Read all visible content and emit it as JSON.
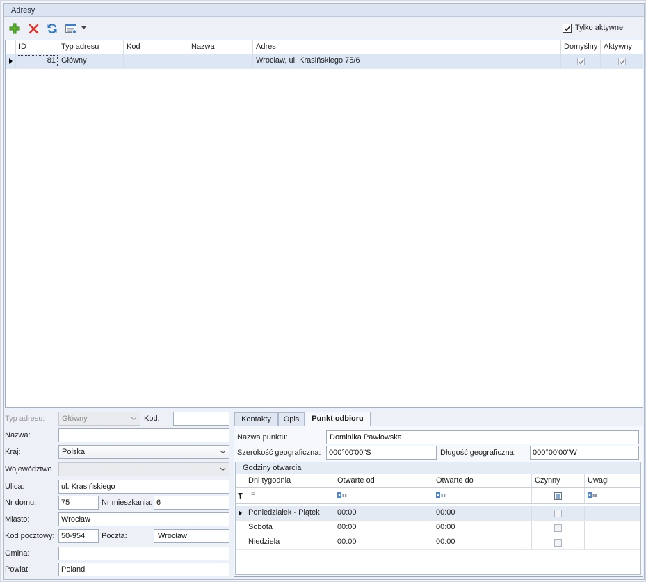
{
  "theme": {
    "panel_bg": "#edf1f7",
    "strip_bg": "#dbe4f0",
    "selected_row": "#dce6f4",
    "border": "#a9b9d0"
  },
  "panel": {
    "title": "Adresy"
  },
  "toolbar": {
    "icons": {
      "add": "plus-icon",
      "delete": "delete-icon",
      "refresh": "refresh-icon",
      "view": "grid-view-icon",
      "view_menu": "dropdown-arrow-icon"
    },
    "only_active": {
      "label": "Tylko aktywne",
      "checked": true
    }
  },
  "grid": {
    "columns": [
      "ID",
      "Typ adresu",
      "Kod",
      "Nazwa",
      "Adres",
      "Domyślny",
      "Aktywny"
    ],
    "rows": [
      {
        "id": "81",
        "type": "Główny",
        "code": "",
        "name": "",
        "address": "Wrocław, ul. Krasińskiego 75/6",
        "default": true,
        "active": true
      }
    ]
  },
  "form": {
    "address_type": {
      "label": "Typ adresu:",
      "value": "Główny"
    },
    "code": {
      "label": "Kod:",
      "value": ""
    },
    "name": {
      "label": "Nazwa:",
      "value": ""
    },
    "country": {
      "label": "Kraj:",
      "value": "Polska"
    },
    "province": {
      "label": "Województwo",
      "value": ""
    },
    "street": {
      "label": "Ulica:",
      "value": "ul. Krasińskiego"
    },
    "house_no": {
      "label": "Nr domu:",
      "value": "75"
    },
    "apartment_no": {
      "label": "Nr mieszkania:",
      "value": "6"
    },
    "city": {
      "label": "Miasto:",
      "value": "Wrocław"
    },
    "postal_code": {
      "label": "Kod pocztowy:",
      "value": "50-954"
    },
    "post_office": {
      "label": "Poczta:",
      "value": "Wrocław"
    },
    "municipality": {
      "label": "Gmina:",
      "value": ""
    },
    "district": {
      "label": "Powiat:",
      "value": "Poland"
    }
  },
  "tabs": [
    {
      "label": "Kontakty",
      "active": false
    },
    {
      "label": "Opis",
      "active": false
    },
    {
      "label": "Punkt odbioru",
      "active": true
    }
  ],
  "pickup_point": {
    "name": {
      "label": "Nazwa punktu:",
      "value": "Dominika Pawłowska"
    },
    "latitude": {
      "label": "Szerokość geograficzna:",
      "value": "000°00'00\"S"
    },
    "longitude": {
      "label": "Długość geograficzna:",
      "value": "000°00'00\"W"
    },
    "opening_hours": {
      "title": "Godziny otwarcia",
      "columns": [
        "Dni tygodnia",
        "Otwarte od",
        "Otwarte do",
        "Czynny",
        "Uwagi"
      ],
      "filter_row": {
        "days_operator": "=",
        "text_filter_icon": "abc-filter-icon"
      },
      "rows": [
        {
          "days": "Poniedziałek - Piątek",
          "open_from": "00:00",
          "open_to": "00:00",
          "active": false,
          "notes": ""
        },
        {
          "days": "Sobota",
          "open_from": "00:00",
          "open_to": "00:00",
          "active": false,
          "notes": ""
        },
        {
          "days": "Niedziela",
          "open_from": "00:00",
          "open_to": "00:00",
          "active": false,
          "notes": ""
        }
      ]
    }
  }
}
